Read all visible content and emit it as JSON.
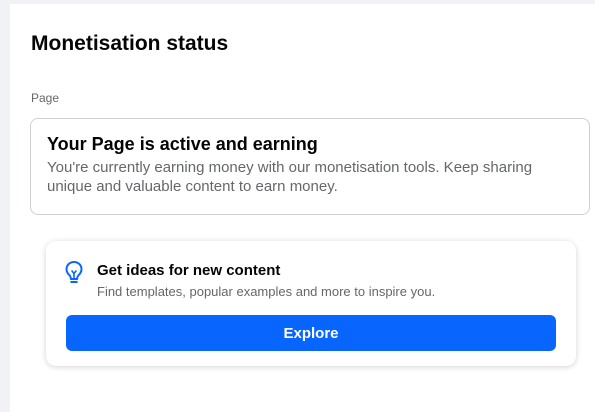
{
  "header": {
    "title": "Monetisation status"
  },
  "section": {
    "label": "Page"
  },
  "status_card": {
    "heading": "Your Page is active and earning",
    "description": "You're currently earning money with our monetisation tools. Keep sharing unique and valuable content to earn money."
  },
  "ideas_card": {
    "icon": "lightbulb-icon",
    "title": "Get ideas for new content",
    "description": "Find templates, popular examples and more to inspire you.",
    "button_label": "Explore"
  },
  "colors": {
    "accent": "#0866ff",
    "icon_blue": "#0866ff",
    "background": "#f0f2f5",
    "secondary_text": "#65676b"
  }
}
